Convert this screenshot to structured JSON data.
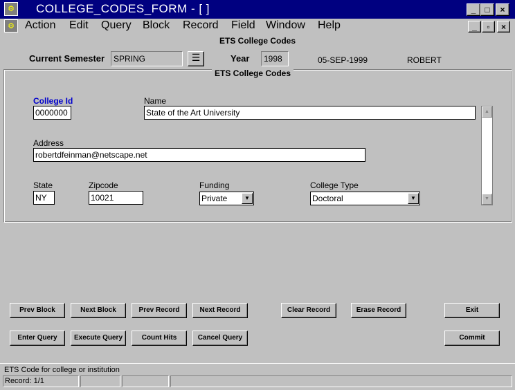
{
  "window": {
    "title": "COLLEGE_CODES_FORM - [ ]",
    "controls": {
      "minimize": "_",
      "maximize": "□",
      "close": "×"
    }
  },
  "menu": {
    "items": [
      "Action",
      "Edit",
      "Query",
      "Block",
      "Record",
      "Field",
      "Window",
      "Help"
    ],
    "doc_controls": {
      "minimize": "_",
      "restore": "▫",
      "close": "×"
    }
  },
  "header": {
    "title": "ETS College Codes",
    "semester_label": "Current Semester",
    "semester_value": "SPRING",
    "year_label": "Year",
    "year_value": "1998",
    "date": "05-SEP-1999",
    "user": "ROBERT"
  },
  "form": {
    "title": "ETS College Codes",
    "college_id_label": "College Id",
    "college_id_value": "0000000",
    "name_label": "Name",
    "name_value": "State of the Art University",
    "address_label": "Address",
    "address_value": "robertdfeinman@netscape.net",
    "state_label": "State",
    "state_value": "NY",
    "zipcode_label": "Zipcode",
    "zipcode_value": "10021",
    "funding_label": "Funding",
    "funding_value": "Private",
    "college_type_label": "College Type",
    "college_type_value": "Doctoral"
  },
  "buttons": {
    "prev_block": "Prev Block",
    "next_block": "Next Block",
    "prev_record": "Prev Record",
    "next_record": "Next Record",
    "clear_record": "Clear Record",
    "erase_record": "Erase Record",
    "exit": "Exit",
    "enter_query": "Enter Query",
    "execute_query": "Execute Query",
    "count_hits": "Count Hits",
    "cancel_query": "Cancel Query",
    "commit": "Commit"
  },
  "status": {
    "hint": "ETS Code for college or institution",
    "record": "Record: 1/1"
  }
}
